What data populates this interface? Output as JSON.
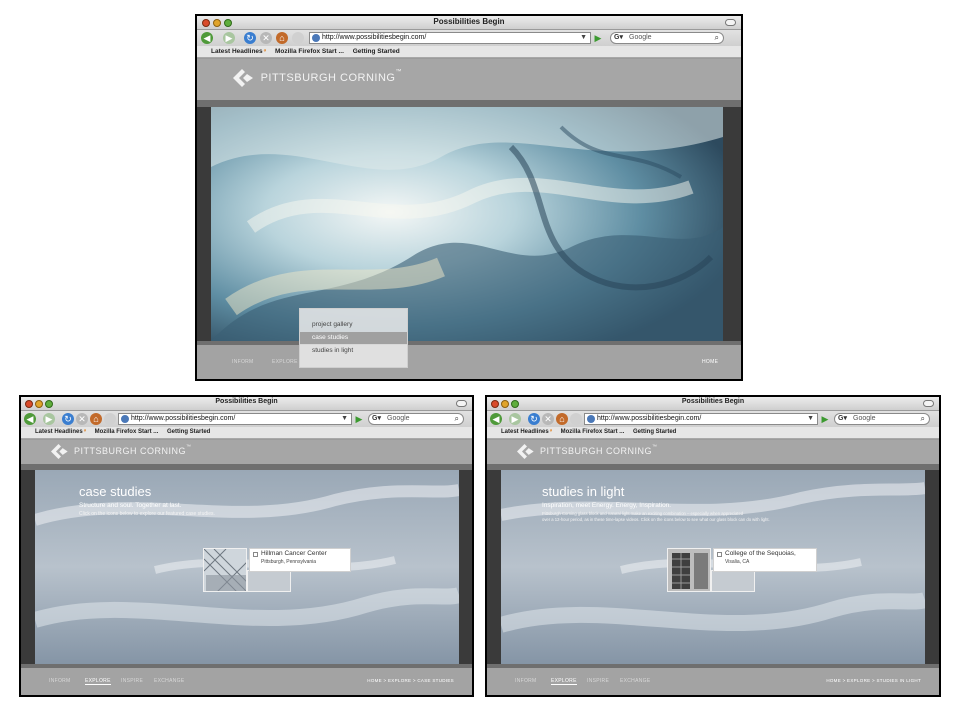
{
  "window": {
    "title": "Possibilities Begin",
    "url": "http://www.possibilitiesbegin.com/",
    "search_placeholder": "Google"
  },
  "bookmarks": [
    "Latest Headlines",
    "Mozilla Firefox Start ...",
    "Getting Started"
  ],
  "logo": {
    "name": "PITTSBURGH CORNING",
    "tm": "™"
  },
  "nav": [
    "INFORM",
    "EXPLORE",
    "INSPIRE",
    "EXCHANGE"
  ],
  "home_label": "HOME",
  "explore_menu": [
    "project gallery",
    "case studies",
    "studies in light"
  ],
  "explore_menu_selected": "case studies",
  "case_studies": {
    "title": "case studies",
    "subtitle": "Structure and soul.  Together at last.",
    "description": "Click on the icons below to explore our featured case studies.",
    "card": {
      "title": "Hillman Cancer Center",
      "subtitle": "Pittsburgh, Pennsylvania"
    },
    "breadcrumb": "HOME > EXPLORE > CASE STUDIES"
  },
  "studies_in_light": {
    "title": "studies in light",
    "subtitle": "Inspiration, meet Energy. Energy, Inspiration.",
    "description_lines": [
      "Pittsburgh Corning glass block and natural light make an exciting combination – especially when appreciated",
      "over a 12-hour period, as in these time-lapse videos. Click on the icons below to see what our glass block can do with light."
    ],
    "card": {
      "title": "College of the Sequoias,",
      "subtitle": "Visalia, CA"
    },
    "breadcrumb": "HOME > EXPLORE > STUDIES IN LIGHT"
  },
  "colors": {
    "page_gray": "#9e9e9e",
    "band_dark": "#6f6f6f",
    "accent_blue": "#6f8fb0"
  }
}
